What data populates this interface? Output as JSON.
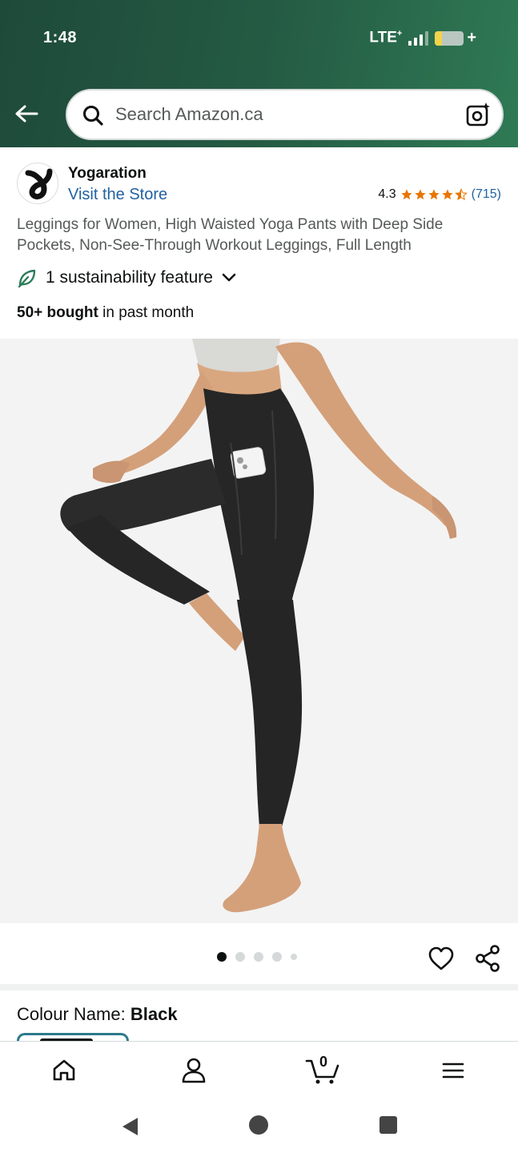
{
  "status_bar": {
    "time": "1:48",
    "network": "LTE",
    "network_sup": "+",
    "battery_plus": "+"
  },
  "search": {
    "placeholder": "Search Amazon.ca"
  },
  "brand": {
    "name": "Yogaration",
    "visit_store": "Visit the Store",
    "rating_value": "4.3",
    "rating_count": "(715)",
    "rating_stars": 4.3,
    "star_color": "#e77600"
  },
  "product": {
    "title": "Leggings for Women, High Waisted Yoga Pants with Deep Side Pockets, Non-See-Through Workout Leggings, Full Length",
    "sustainability": "1 sustainability feature",
    "bought_bold": "50+ bought",
    "bought_rest": " in past month"
  },
  "gallery": {
    "total_images": 5,
    "active_index": 0
  },
  "colour": {
    "label": "Colour Name: ",
    "value": "Black"
  },
  "cart": {
    "count": "0"
  },
  "colors": {
    "header_start": "#1e4a3a",
    "header_end": "#2f7a55",
    "link": "#2162a1",
    "sustain_green": "#2e7d5b"
  },
  "icons": {
    "back": "arrow-left-icon",
    "search": "search-icon",
    "camera": "camera-lens-icon",
    "sustainability": "leaf-icon",
    "wishlist": "heart-icon",
    "share": "share-icon",
    "home": "home-icon",
    "account": "person-icon",
    "cart": "cart-icon",
    "menu": "hamburger-menu-icon"
  }
}
